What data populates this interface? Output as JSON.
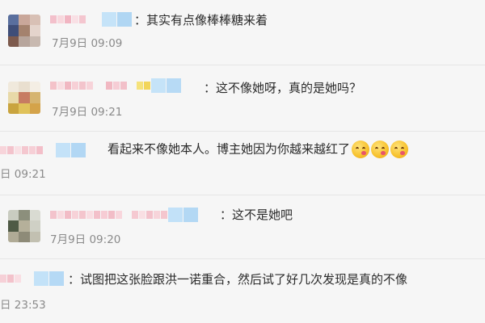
{
  "comments": [
    {
      "text": "：其实有点像棒棒糖来着",
      "time": "7月9日 09:09"
    },
    {
      "text": "：这不像她呀，真的是她吗？",
      "time": "7月9日 09:21"
    },
    {
      "text": "看起来不像她本人。博主她因为你越来越红了",
      "time": "日 09:21",
      "emoji_icon": "smiling-blushing-emoji",
      "emoji_count": 3
    },
    {
      "text": "：这不是她吧",
      "time": "7月9日 09:20"
    },
    {
      "text": "：试图把这张脸跟洪一诺重合，然后试了好几次发现是真的不像",
      "time": "日 23:53"
    }
  ],
  "colors": {
    "background": "#f6f6f6",
    "text": "#2b2b2b",
    "time": "#8a8a8a",
    "username_mosaic_pink": "#f6cdd5",
    "username_mosaic_blue": "#bfe0f7",
    "divider": "#e6e6e6"
  }
}
